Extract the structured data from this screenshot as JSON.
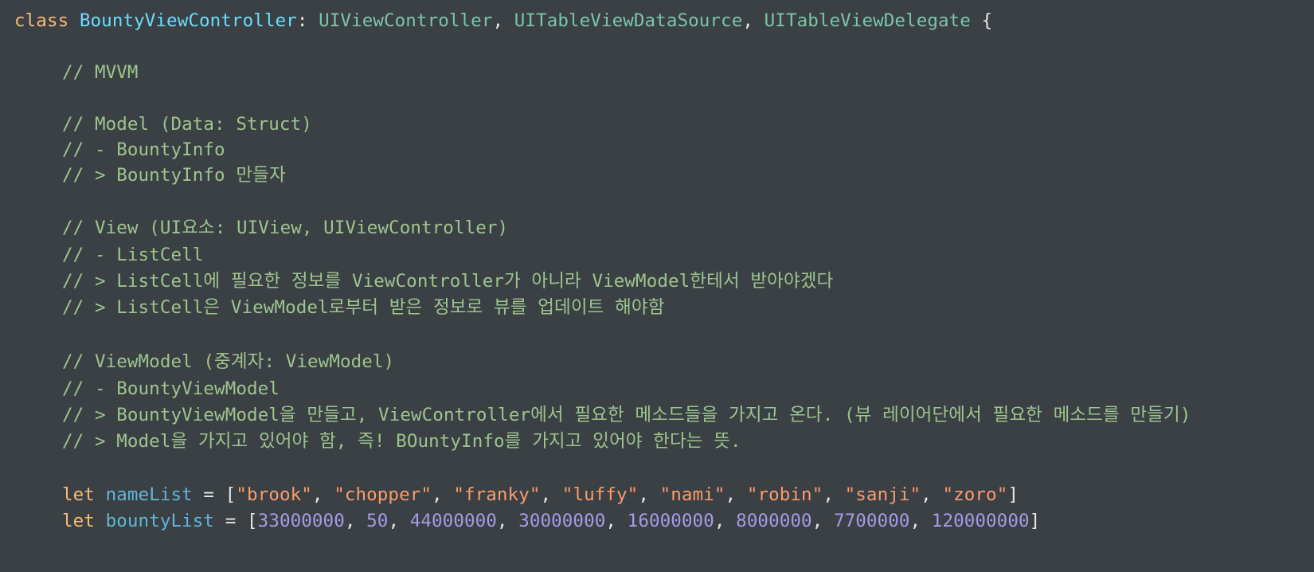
{
  "colors": {
    "background": "#3b4045",
    "keyword": "#f2bd76",
    "type_declaration": "#6bdcff",
    "type_reference": "#7bc5a6",
    "comment": "#9ec48e",
    "identifier": "#5fb6d8",
    "string": "#fb9c6b",
    "number": "#a69be6",
    "plain": "#e7e7e7"
  },
  "code": {
    "class_line": {
      "keyword": "class",
      "name": "BountyViewController",
      "colon": ":",
      "conformances": [
        "UIViewController",
        "UITableViewDataSource",
        "UITableViewDelegate"
      ],
      "brace": "{"
    },
    "comments": [
      "// MVVM",
      "// Model (Data: Struct)",
      "// - BountyInfo",
      "// > BountyInfo 만들자",
      "// View (UI요소: UIView, UIViewController)",
      "// - ListCell",
      "// > ListCell에 필요한 정보를 ViewController가 아니라 ViewModel한테서 받아야겠다",
      "// > ListCell은 ViewModel로부터 받은 정보로 뷰를 업데이트 해야함",
      "// ViewModel (중계자: ViewModel)",
      "// - BountyViewModel",
      "// > BountyViewModel을 만들고, ViewController에서 필요한 메소드들을 가지고 온다. (뷰 레이어단에서 필요한 메소드를 만들기)",
      "// > Model을 가지고 있어야 함, 즉! BOuntyInfo를 가지고 있어야 한다는 뜻."
    ],
    "name_list": {
      "keyword": "let",
      "identifier": "nameList",
      "values": [
        "\"brook\"",
        "\"chopper\"",
        "\"franky\"",
        "\"luffy\"",
        "\"nami\"",
        "\"robin\"",
        "\"sanji\"",
        "\"zoro\""
      ]
    },
    "bounty_list": {
      "keyword": "let",
      "identifier": "bountyList",
      "values": [
        "33000000",
        "50",
        "44000000",
        "30000000",
        "16000000",
        "8000000",
        "7700000",
        "120000000"
      ]
    }
  }
}
